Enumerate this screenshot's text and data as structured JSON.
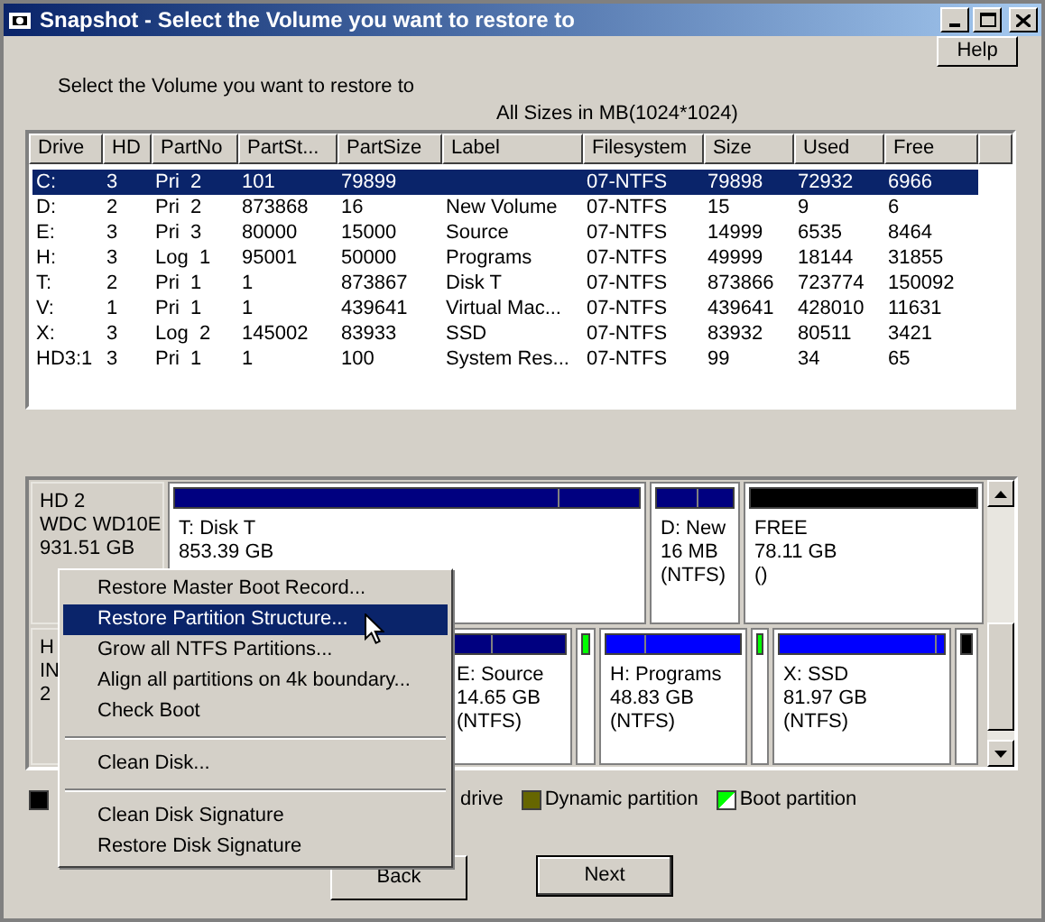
{
  "window": {
    "title": "Snapshot - Select the Volume you want to restore to"
  },
  "help_button": "Help",
  "instruction": "Select the Volume you want to restore to",
  "units_note": "All Sizes in MB(1024*1024)",
  "table": {
    "columns": [
      "Drive",
      "HD",
      "PartNo",
      "PartSt...",
      "PartSize",
      "Label",
      "Filesystem",
      "Size",
      "Used",
      "Free"
    ],
    "rows": [
      {
        "selected": true,
        "cells": [
          "C:",
          "3",
          "Pri  2",
          "101",
          "79899",
          "",
          "07-NTFS",
          "79898",
          "72932",
          "6966"
        ]
      },
      {
        "selected": false,
        "cells": [
          "D:",
          "2",
          "Pri  2",
          "873868",
          "16",
          "New Volume",
          "07-NTFS",
          "15",
          "9",
          "6"
        ]
      },
      {
        "selected": false,
        "cells": [
          "E:",
          "3",
          "Pri  3",
          "80000",
          "15000",
          "Source",
          "07-NTFS",
          "14999",
          "6535",
          "8464"
        ]
      },
      {
        "selected": false,
        "cells": [
          "H:",
          "3",
          "Log  1",
          "95001",
          "50000",
          "Programs",
          "07-NTFS",
          "49999",
          "18144",
          "31855"
        ]
      },
      {
        "selected": false,
        "cells": [
          "T:",
          "2",
          "Pri  1",
          "1",
          "873867",
          "Disk T",
          "07-NTFS",
          "873866",
          "723774",
          "150092"
        ]
      },
      {
        "selected": false,
        "cells": [
          "V:",
          "1",
          "Pri  1",
          "1",
          "439641",
          "Virtual Mac...",
          "07-NTFS",
          "439641",
          "428010",
          "11631"
        ]
      },
      {
        "selected": false,
        "cells": [
          "X:",
          "3",
          "Log  2",
          "145002",
          "83933",
          "SSD",
          "07-NTFS",
          "83932",
          "80511",
          "3421"
        ]
      },
      {
        "selected": false,
        "cells": [
          "HD3:1",
          "3",
          "Pri  1",
          "1",
          "100",
          "System Res...",
          "07-NTFS",
          "99",
          "34",
          "65"
        ]
      }
    ]
  },
  "disks": [
    {
      "label_lines": [
        "HD 2",
        "WDC WD10E",
        "931.51 GB"
      ],
      "partitions": [
        {
          "color": "#000080",
          "level": 0.83,
          "lines": [
            "T: Disk T",
            "853.39 GB"
          ]
        },
        {
          "color": "#000080",
          "level": 0.55,
          "lines": [
            "D: New",
            "16 MB",
            "(NTFS)"
          ]
        },
        {
          "color": "#000000",
          "lines": [
            "FREE",
            "78.11 GB",
            "()"
          ]
        }
      ]
    },
    {
      "label_lines": [
        "H",
        "IN",
        "2"
      ],
      "partitions": [
        {
          "color": "#000080",
          "level": 0.36,
          "lines": [
            "E: Source",
            "14.65 GB",
            "(NTFS)"
          ]
        },
        {
          "color": "#00ff00"
        },
        {
          "color": "#0000ff",
          "level": 0.3,
          "lines": [
            "H: Programs",
            "48.83 GB",
            "(NTFS)"
          ]
        },
        {
          "color": "#00ff00"
        },
        {
          "color": "#0000ff",
          "level": 0.96,
          "lines": [
            "X: SSD",
            "81.97 GB",
            "(NTFS)"
          ]
        },
        {
          "color": "#000000"
        }
      ]
    }
  ],
  "legend": [
    {
      "color": "#000000"
    },
    {
      "label": "drive"
    },
    {
      "color": "#666600",
      "label": "Dynamic partition"
    },
    {
      "color": "#00ff00",
      "label": "Boot partition"
    }
  ],
  "context_menu": [
    {
      "kind": "item",
      "label": "Restore Master Boot Record...",
      "selected": false
    },
    {
      "kind": "item",
      "label": "Restore Partition Structure...",
      "selected": true
    },
    {
      "kind": "item",
      "label": "Grow all NTFS Partitions...",
      "selected": false
    },
    {
      "kind": "item",
      "label": "Align all partitions on 4k boundary...",
      "selected": false
    },
    {
      "kind": "item",
      "label": "Check Boot",
      "selected": false
    },
    {
      "kind": "separator"
    },
    {
      "kind": "item",
      "label": "Clean Disk...",
      "selected": false
    },
    {
      "kind": "separator"
    },
    {
      "kind": "item",
      "label": "Clean Disk Signature",
      "selected": false
    },
    {
      "kind": "item",
      "label": "Restore Disk Signature",
      "selected": false
    }
  ],
  "buttons": [
    "Back",
    "Next"
  ]
}
